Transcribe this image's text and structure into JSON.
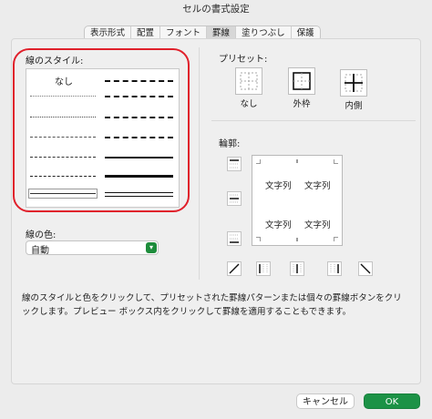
{
  "window": {
    "title": "セルの書式設定"
  },
  "tabs": [
    {
      "label": "表示形式"
    },
    {
      "label": "配置"
    },
    {
      "label": "フォント"
    },
    {
      "label": "罫線",
      "active": true
    },
    {
      "label": "塗りつぶし"
    },
    {
      "label": "保護"
    }
  ],
  "line_style": {
    "label": "線のスタイル:",
    "none_label": "なし"
  },
  "line_color": {
    "label": "線の色:",
    "value": "自動"
  },
  "presets": {
    "label": "プリセット:",
    "items": [
      {
        "label": "なし",
        "icon": "border-none-icon"
      },
      {
        "label": "外枠",
        "icon": "border-outline-icon"
      },
      {
        "label": "内側",
        "icon": "border-inside-icon"
      }
    ]
  },
  "border": {
    "label": "輪郭:",
    "preview_text": [
      "文字列",
      "文字列",
      "文字列",
      "文字列"
    ]
  },
  "description": "線のスタイルと色をクリックして、プリセットされた罫線パターンまたは個々の罫線ボタンをクリックします。プレビュー ボックス内をクリックして罫線を適用することもできます。",
  "buttons": {
    "cancel": "キャンセル",
    "ok": "OK"
  },
  "colors": {
    "accent": "#1c9246",
    "highlight_ring": "#e0202b"
  }
}
